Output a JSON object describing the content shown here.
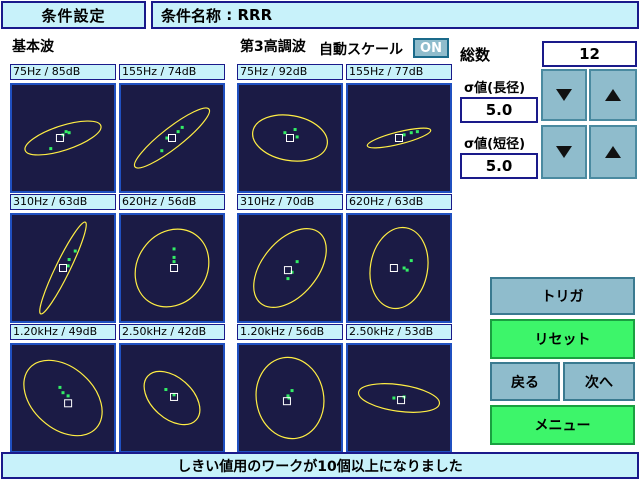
{
  "header": {
    "section": "条件設定",
    "name_label": "条件名称",
    "name_sep": " : ",
    "name_value": "RRR"
  },
  "sections": {
    "fundamental": "基本波",
    "third": "第3高調波"
  },
  "auto_scale": {
    "label": "自動スケール",
    "state": "ON"
  },
  "total": {
    "label": "総数",
    "value": "12"
  },
  "sigma_long": {
    "label": "σ値(長径)",
    "value": "5.0"
  },
  "sigma_short": {
    "label": "σ値(短径)",
    "value": "5.0"
  },
  "buttons": {
    "trigger": "トリガ",
    "reset": "リセット",
    "back": "戻る",
    "next": "次へ",
    "menu": "メニュー"
  },
  "status": "しきい値用のワークが10個以上になりました",
  "colors": {
    "plot_bg": "#1b1b45",
    "ellipse": "#ffee44",
    "point": "#33ee66",
    "panel": "#c8f2fa",
    "green_btn": "#3df56a"
  },
  "plots": [
    {
      "label": "75Hz / 85dB",
      "ellipse": {
        "rx": 0.39,
        "ry": 0.12,
        "angle": -18
      },
      "points": [
        [
          0.5,
          0.47
        ],
        [
          0.53,
          0.44
        ],
        [
          0.56,
          0.45
        ],
        [
          0.38,
          0.6
        ]
      ],
      "marker": [
        0.47,
        0.5
      ]
    },
    {
      "label": "155Hz / 74dB",
      "ellipse": {
        "rx": 0.46,
        "ry": 0.1,
        "angle": -38
      },
      "points": [
        [
          0.56,
          0.44
        ],
        [
          0.6,
          0.4
        ],
        [
          0.4,
          0.62
        ],
        [
          0.45,
          0.5
        ]
      ],
      "marker": [
        0.5,
        0.5
      ]
    },
    {
      "label": "310Hz / 63dB",
      "ellipse": {
        "rx": 0.5,
        "ry": 0.07,
        "angle": -64
      },
      "points": [
        [
          0.56,
          0.42
        ],
        [
          0.62,
          0.34
        ],
        [
          0.55,
          0.48
        ]
      ],
      "marker": [
        0.5,
        0.5
      ]
    },
    {
      "label": "620Hz / 56dB",
      "ellipse": {
        "rx": 0.4,
        "ry": 0.34,
        "angle": -55
      },
      "points": [
        [
          0.52,
          0.32
        ],
        [
          0.52,
          0.4
        ],
        [
          0.52,
          0.44
        ]
      ],
      "marker": [
        0.52,
        0.5
      ]
    },
    {
      "label": "1.20kHz / 49dB",
      "ellipse": {
        "rx": 0.44,
        "ry": 0.3,
        "angle": 42
      },
      "points": [
        [
          0.47,
          0.4
        ],
        [
          0.5,
          0.45
        ],
        [
          0.55,
          0.48
        ]
      ],
      "marker": [
        0.55,
        0.55
      ]
    },
    {
      "label": "2.50kHz / 42dB",
      "ellipse": {
        "rx": 0.32,
        "ry": 0.2,
        "angle": 42
      },
      "points": [
        [
          0.52,
          0.47
        ],
        [
          0.44,
          0.42
        ]
      ],
      "marker": [
        0.52,
        0.49
      ]
    },
    {
      "label": "75Hz / 92dB",
      "ellipse": {
        "rx": 0.37,
        "ry": 0.22,
        "angle": 10
      },
      "points": [
        [
          0.55,
          0.42
        ],
        [
          0.57,
          0.49
        ],
        [
          0.45,
          0.45
        ]
      ],
      "marker": [
        0.5,
        0.5
      ]
    },
    {
      "label": "155Hz / 77dB",
      "ellipse": {
        "rx": 0.32,
        "ry": 0.06,
        "angle": -14
      },
      "points": [
        [
          0.55,
          0.47
        ],
        [
          0.62,
          0.45
        ],
        [
          0.68,
          0.44
        ]
      ],
      "marker": [
        0.5,
        0.5
      ]
    },
    {
      "label": "310Hz / 70dB",
      "ellipse": {
        "rx": 0.45,
        "ry": 0.27,
        "angle": -50
      },
      "points": [
        [
          0.57,
          0.44
        ],
        [
          0.52,
          0.54
        ],
        [
          0.48,
          0.6
        ]
      ],
      "marker": [
        0.48,
        0.52
      ]
    },
    {
      "label": "620Hz / 63dB",
      "ellipse": {
        "rx": 0.28,
        "ry": 0.4,
        "angle": 10
      },
      "points": [
        [
          0.62,
          0.43
        ],
        [
          0.55,
          0.5
        ],
        [
          0.58,
          0.52
        ]
      ],
      "marker": [
        0.45,
        0.5
      ]
    },
    {
      "label": "1.20kHz / 56dB",
      "ellipse": {
        "rx": 0.33,
        "ry": 0.4,
        "angle": -10
      },
      "points": [
        [
          0.52,
          0.43
        ],
        [
          0.48,
          0.48
        ],
        [
          0.49,
          0.5
        ]
      ],
      "marker": [
        0.47,
        0.53
      ]
    },
    {
      "label": "2.50kHz / 53dB",
      "ellipse": {
        "rx": 0.4,
        "ry": 0.13,
        "angle": 8
      },
      "points": [
        [
          0.45,
          0.5
        ],
        [
          0.55,
          0.49
        ]
      ],
      "marker": [
        0.52,
        0.52
      ]
    }
  ]
}
